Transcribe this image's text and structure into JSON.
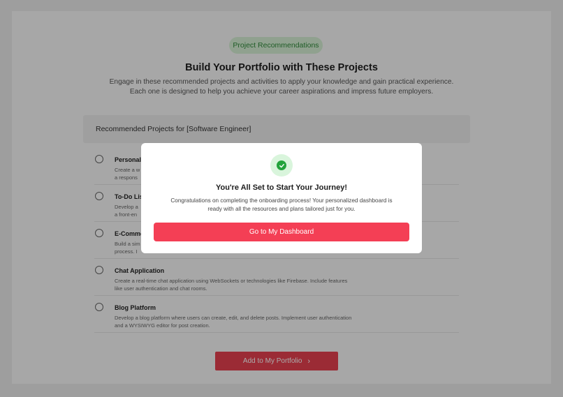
{
  "header": {
    "badge": "Project Recommendations",
    "title": "Build Your Portfolio with These Projects",
    "subtitle_line1": "Engage in these recommended projects and activities to apply your knowledge and gain practical experience.",
    "subtitle_line2": "Each one is designed to help you achieve your career aspirations and impress future employers."
  },
  "recommendations": {
    "header": "Recommended Projects for [Software Engineer]",
    "items": [
      {
        "title": "Personal P",
        "desc": "Create a w",
        "desc2": "a respons"
      },
      {
        "title": "To-Do List",
        "desc": "Develop a",
        "desc2": "a front-en"
      },
      {
        "title": "E-Comme",
        "desc": "Build a sim",
        "desc2": "process. I"
      },
      {
        "title": "Chat Application",
        "desc": "Create a real-time chat application using WebSockets or technologies like Firebase. Include features",
        "desc2": "like user authentication and chat rooms."
      },
      {
        "title": "Blog Platform",
        "desc": "Develop a blog platform where users can create, edit, and delete posts. Implement user authentication",
        "desc2": "and a WYSIWYG editor for post creation."
      }
    ]
  },
  "footer": {
    "add_button": "Add to My Portfolio",
    "chevron": "›"
  },
  "modal": {
    "icon": "check-circle-icon",
    "title": "You're All Set to Start Your Journey!",
    "desc_line1": "Congratulations on completing the onboarding process! Your personalized dashboard is",
    "desc_line2": "ready with all the resources and plans tailored just for you.",
    "button": "Go to My Dashboard"
  },
  "colors": {
    "accent": "#f43f55",
    "success": "#22a33b",
    "badge_bg": "#d7f1d6"
  }
}
